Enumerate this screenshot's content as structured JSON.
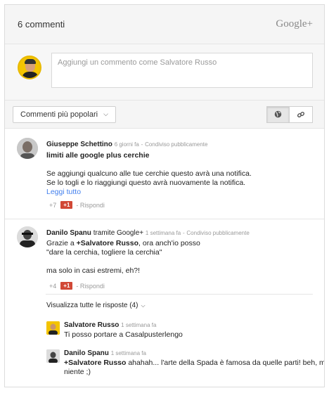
{
  "header": {
    "count": "6 commenti",
    "brand": "Google+"
  },
  "compose": {
    "placeholder": "Aggiungi un commento come Salvatore Russo"
  },
  "toolbar": {
    "sort_label": "Commenti più popolari",
    "sort_icon": "chevron-down-icon",
    "view_buttons": [
      {
        "icon": "globe-icon",
        "active": true
      },
      {
        "icon": "link-icon",
        "active": false
      }
    ]
  },
  "comments": [
    {
      "author": "Giuseppe Schettino",
      "time": "6 giorni fa",
      "visibility": "Condiviso pubblicamente",
      "headline": "limiti alle google plus cerchie",
      "lines": [
        "Se aggiungi qualcuno alle tue cerchie questo avrà una notifica.",
        "Se lo togli e lo riaggiungi questo avrà nuovamente la notifica."
      ],
      "read_more": "Leggi tutto",
      "plus_count": "+7",
      "plus_label": "+1",
      "reply_label": "Rispondi"
    },
    {
      "author": "Danilo Spanu",
      "via_text": "tramite Google+",
      "time": "1 settimana fa",
      "visibility": "Condiviso pubblicamente",
      "line1_prefix": "Grazie a ",
      "line1_mention": "+Salvatore Russo",
      "line1_suffix": ", ora anch'io posso",
      "line2": "\"dare la cerchia, togliere la cerchia\"",
      "line3": "ma solo in casi estremi, eh?!",
      "plus_count": "+4",
      "plus_label": "+1",
      "reply_label": "Rispondi",
      "replies_toggle": "Visualizza tutte le risposte (4)",
      "replies": [
        {
          "author": "Salvatore Russo",
          "time": "1 settimana fa",
          "text": "Ti posso portare a Casalpusterlengo"
        },
        {
          "author": "Danilo Spanu",
          "time": "1 settimana fa",
          "mention": "+Salvatore Russo",
          "text_after": " ahahah... l'arte della Spada è famosa da quelle parti! beh, meglio di",
          "text_line2": "niente ;)"
        }
      ]
    }
  ]
}
